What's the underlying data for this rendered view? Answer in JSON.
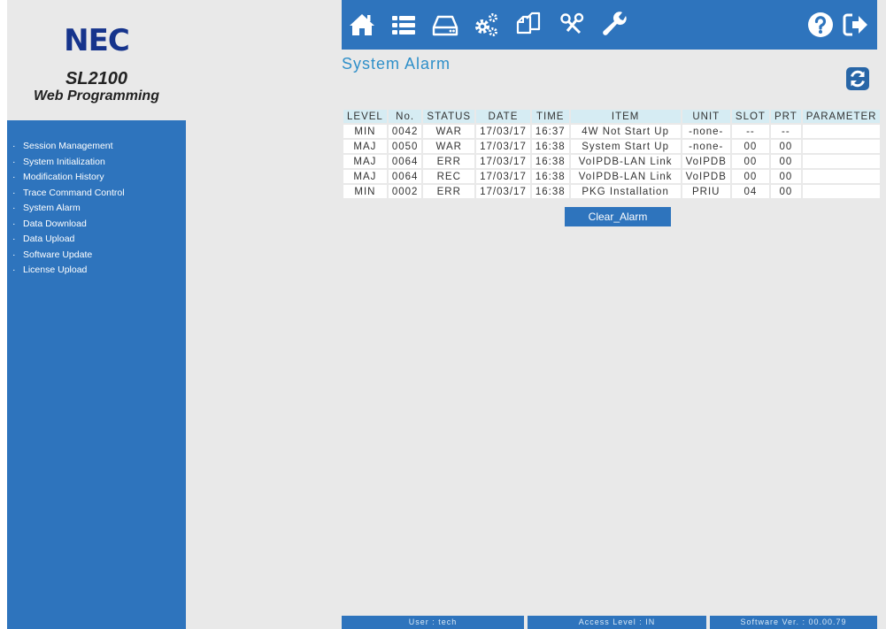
{
  "brand": {
    "logo": "NEC",
    "product": "SL2100",
    "subtitle": "Web Programming"
  },
  "sidebar": {
    "items": [
      {
        "label": "Session Management"
      },
      {
        "label": "System Initialization"
      },
      {
        "label": "Modification History"
      },
      {
        "label": "Trace Command Control"
      },
      {
        "label": "System Alarm"
      },
      {
        "label": "Data Download"
      },
      {
        "label": "Data Upload"
      },
      {
        "label": "Software Update"
      },
      {
        "label": "License Upload"
      }
    ]
  },
  "toolbar": {
    "icons": [
      "home-icon",
      "list-icon",
      "drive-icon",
      "gears-icon",
      "copy-icon",
      "tools-icon",
      "wrench-icon",
      "help-icon",
      "logout-icon"
    ]
  },
  "page": {
    "title": "System Alarm",
    "refresh_icon": "refresh-icon"
  },
  "table": {
    "headers": [
      "LEVEL",
      "No.",
      "STATUS",
      "DATE",
      "TIME",
      "ITEM",
      "UNIT",
      "SLOT",
      "PRT",
      "PARAMETER"
    ],
    "rows": [
      [
        "MIN",
        "0042",
        "WAR",
        "17/03/17",
        "16:37",
        "4W Not Start Up",
        "-none-",
        "--",
        "--",
        ""
      ],
      [
        "MAJ",
        "0050",
        "WAR",
        "17/03/17",
        "16:38",
        "System Start Up",
        "-none-",
        "00",
        "00",
        ""
      ],
      [
        "MAJ",
        "0064",
        "ERR",
        "17/03/17",
        "16:38",
        "VoIPDB-LAN Link",
        "VoIPDB",
        "00",
        "00",
        ""
      ],
      [
        "MAJ",
        "0064",
        "REC",
        "17/03/17",
        "16:38",
        "VoIPDB-LAN Link",
        "VoIPDB",
        "00",
        "00",
        ""
      ],
      [
        "MIN",
        "0002",
        "ERR",
        "17/03/17",
        "16:38",
        "PKG Installation",
        "PRIU",
        "04",
        "00",
        ""
      ]
    ]
  },
  "actions": {
    "clear_label": "Clear_Alarm"
  },
  "status_bar": {
    "user": "User : tech",
    "access": "Access Level : IN",
    "version": "Software Ver. : 00.00.79"
  },
  "colors": {
    "brand_blue": "#2e74bd",
    "logo_navy": "#16348c",
    "title_blue": "#2e8fc9",
    "header_cell": "#d6ecf3",
    "background": "#e9e9e9"
  }
}
